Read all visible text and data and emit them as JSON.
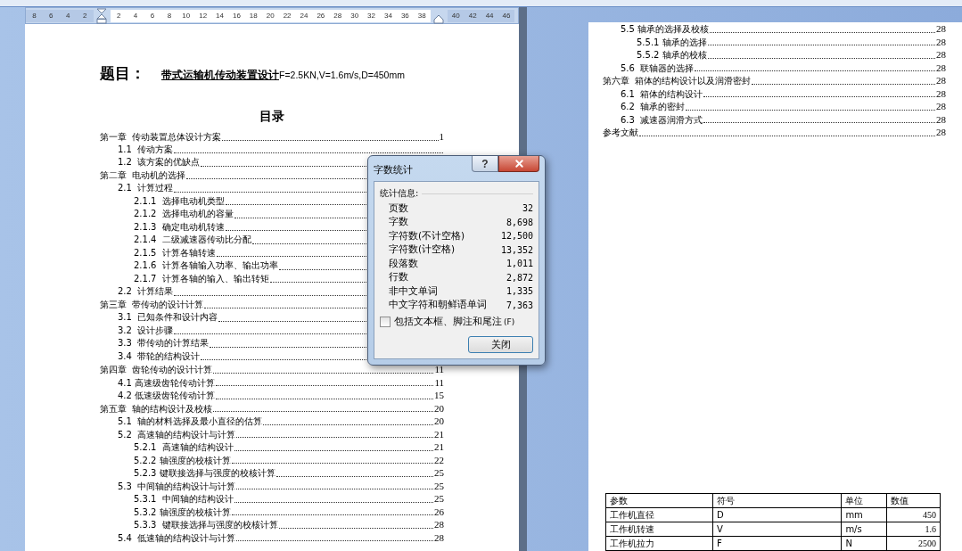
{
  "ruler": {
    "labels_before": [
      "8",
      "6",
      "4",
      "2"
    ],
    "labels_inside": [
      "2",
      "4",
      "6",
      "8",
      "10",
      "12",
      "14",
      "16",
      "18",
      "20",
      "22",
      "24",
      "26",
      "28",
      "30",
      "32",
      "34",
      "36",
      "38"
    ],
    "labels_after": [
      "40",
      "42",
      "44",
      "46"
    ]
  },
  "left_page": {
    "subject_label": "题目：",
    "subject_title": "带式运输机传动装置设计",
    "subject_params": "F=2.5KN,V=1.6m/s,D=450mm",
    "toc_title": "目录",
    "toc": [
      {
        "label": "第一章  传动装置总体设计方案",
        "page": "1",
        "children": [
          {
            "label": "1.1  传动方案"
          },
          {
            "label": "1.2  该方案的优缺点"
          }
        ]
      },
      {
        "label": "第二章  电动机的选择",
        "children": [
          {
            "label": "2.1  计算过程",
            "children": [
              {
                "label": "2.1.1  选择电动机类型"
              },
              {
                "label": "2.1.2  选择电动机的容量"
              },
              {
                "label": "2.1.3  确定电动机转速"
              },
              {
                "label": "2.1.4  二级减速器传动比分配"
              },
              {
                "label": "2.1.5  计算各轴转速"
              },
              {
                "label": "2.1.6  计算各轴输入功率、输出功率"
              },
              {
                "label": "2.1.7  计算各轴的输入、输出转矩"
              }
            ]
          },
          {
            "label": "2.2  计算结果"
          }
        ]
      },
      {
        "label": "第三章  带传动的设计计算",
        "children": [
          {
            "label": "3.1  已知条件和设计内容"
          },
          {
            "label": "3.2  设计步骤"
          },
          {
            "label": "3.3  带传动的计算结果"
          },
          {
            "label": "3.4  带轮的结构设计"
          }
        ]
      },
      {
        "label": "第四章  齿轮传动的设计计算",
        "page": "11",
        "children": [
          {
            "label": "4.1 高速级齿轮传动计算",
            "page": "11"
          },
          {
            "label": "4.2 低速级齿轮传动计算",
            "page": "15"
          }
        ]
      },
      {
        "label": "第五章  轴的结构设计及校核",
        "page": "20",
        "children": [
          {
            "label": "5.1  轴的材料选择及最小直径的估算",
            "page": "20"
          },
          {
            "label": "5.2  高速轴的结构设计与计算",
            "page": "21",
            "children": [
              {
                "label": "5.2.1  高速轴的结构设计",
                "page": "21"
              },
              {
                "label": "5.2.2 轴强度的校核计算",
                "page": "22"
              },
              {
                "label": "5.2.3 键联接选择与强度的校核计算",
                "page": "25"
              }
            ]
          },
          {
            "label": "5.3  中间轴的结构设计与计算",
            "page": "25",
            "children": [
              {
                "label": "5.3.1  中间轴的结构设计",
                "page": "25"
              },
              {
                "label": "5.3.2 轴强度的校核计算",
                "page": "26"
              },
              {
                "label": "5.3.3  键联接选择与强度的校核计算",
                "page": "28"
              }
            ]
          },
          {
            "label": "5.4  低速轴的结构设计与计算",
            "page": "28"
          }
        ]
      }
    ]
  },
  "right_page": {
    "toc_continued": [
      {
        "label": "5.5 轴承的选择及校核",
        "page": "28",
        "children": [
          {
            "label": "5.5.1 轴承的选择",
            "page": "28"
          },
          {
            "label": "5.5.2 轴承的校核",
            "page": "28"
          }
        ]
      },
      {
        "label": "5.6  联轴器的选择",
        "page": "28"
      }
    ],
    "toc": [
      {
        "label": "第六章  箱体的结构设计以及润滑密封",
        "page": "28",
        "children": [
          {
            "label": "6.1  箱体的结构设计",
            "page": "28"
          },
          {
            "label": "6.2  轴承的密封",
            "page": "28"
          },
          {
            "label": "6.3  减速器润滑方式",
            "page": "28"
          }
        ]
      },
      {
        "label": "参考文献",
        "page": "28"
      }
    ],
    "table": {
      "columns": [
        "参数",
        "符号",
        "单位",
        "数值"
      ],
      "rows": [
        [
          "工作机直径",
          "D",
          "mm",
          "450"
        ],
        [
          "工作机转速",
          "V",
          "m/s",
          "1.6"
        ],
        [
          "工作机拉力",
          "F",
          "N",
          "2500"
        ]
      ]
    }
  },
  "dialog": {
    "title": "字数统计",
    "help_label": "?",
    "group_label": "统计信息:",
    "stats": [
      {
        "label": "页数",
        "value": "32"
      },
      {
        "label": "字数",
        "value": "8,698"
      },
      {
        "label": "字符数(不计空格)",
        "value": "12,500"
      },
      {
        "label": "字符数(计空格)",
        "value": "13,352"
      },
      {
        "label": "段落数",
        "value": "1,011"
      },
      {
        "label": "行数",
        "value": "2,872"
      },
      {
        "label": "非中文单词",
        "value": "1,335"
      },
      {
        "label": "中文字符和朝鲜语单词",
        "value": "7,363"
      }
    ],
    "checkbox": {
      "label": "包括文本框、脚注和尾注",
      "access_key": "(F)",
      "checked": false
    },
    "close_button": "关闭"
  }
}
